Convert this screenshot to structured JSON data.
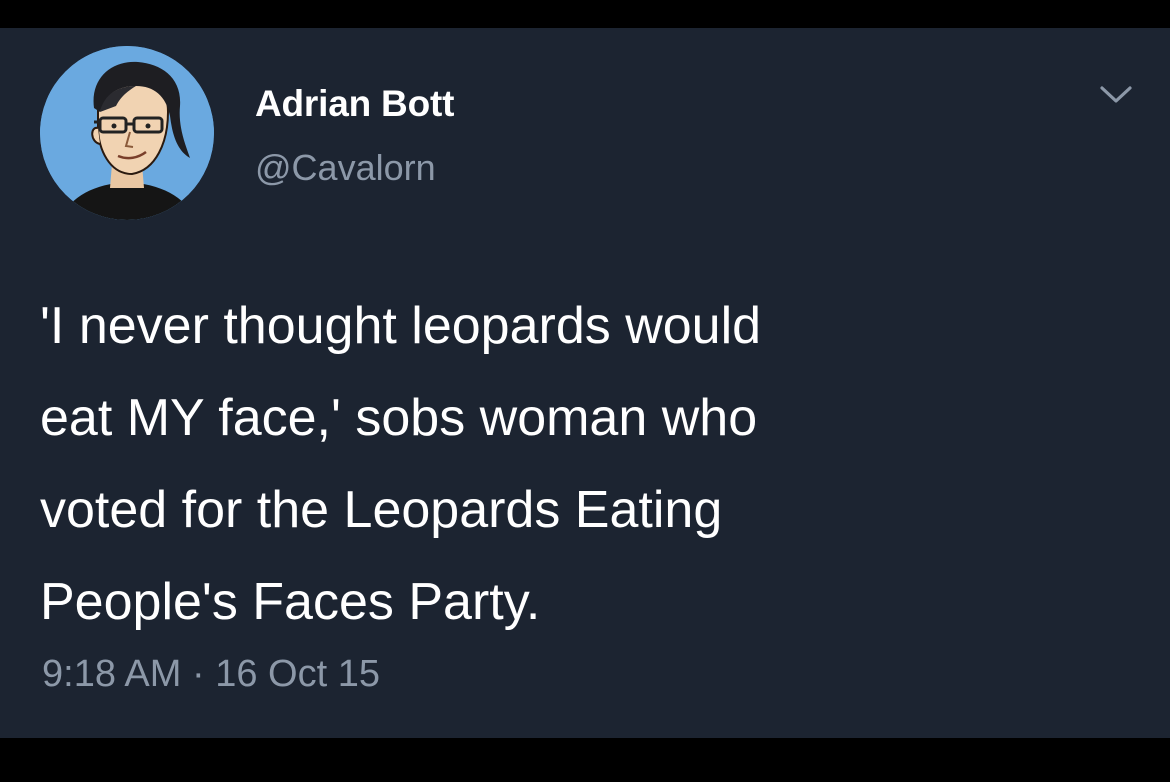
{
  "tweet": {
    "author_name": "Adrian Bott",
    "author_handle": "@Cavalorn",
    "text": "'I never thought leopards would\neat MY face,' sobs woman who\nvoted for the Leopards Eating\nPeople's Faces Party.",
    "time": "9:18 AM",
    "separator": " · ",
    "date": "16 Oct 15",
    "menu_icon": "chevron-down-icon",
    "avatar_icon": "avatar-cartoon-man-glasses"
  },
  "colors": {
    "background": "#1c2431",
    "text": "#ffffff",
    "secondary_text": "#8c98a8",
    "avatar_bg": "#6aa9e0"
  }
}
